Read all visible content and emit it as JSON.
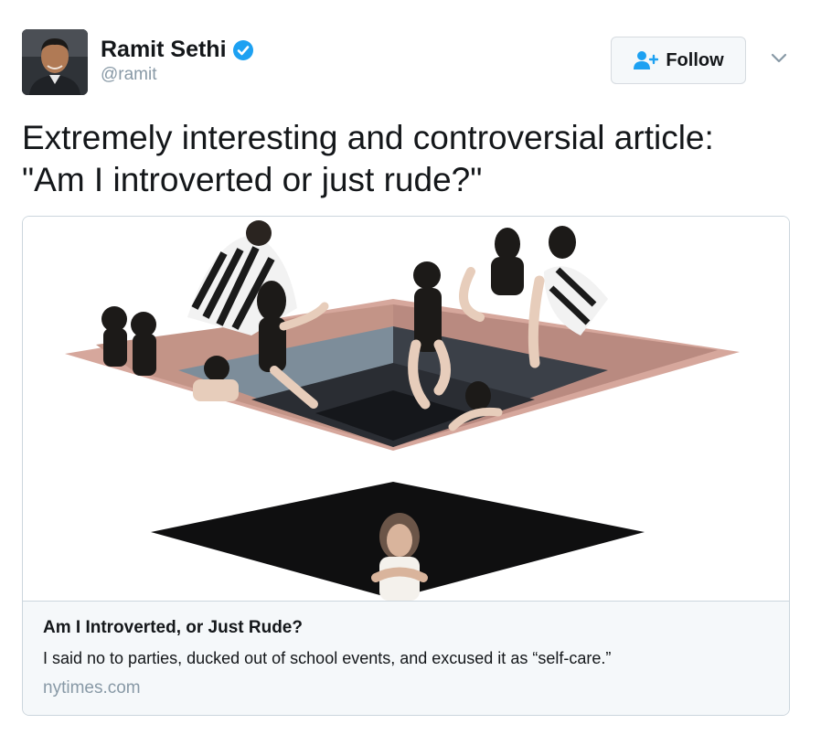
{
  "author": {
    "name": "Ramit Sethi",
    "handle": "@ramit",
    "verified": true,
    "avatar_icon": "profile-photo"
  },
  "actions": {
    "follow_label": "Follow",
    "follow_icon": "add-user-icon",
    "menu_icon": "chevron-down-icon"
  },
  "tweet": {
    "text": "Extremely interesting and controversial article:\n\"Am I introverted or just rude?\""
  },
  "card": {
    "image_description_icon": "illustration",
    "title": "Am I Introverted, or Just Rude?",
    "description": "I said no to parties, ducked out of school events, and excused it as “self-care.”",
    "domain": "nytimes.com"
  },
  "colors": {
    "verified_blue": "#1da1f2",
    "muted_text": "#8899a6",
    "border": "#ccd6dd",
    "card_body_bg": "#f5f8fa"
  }
}
